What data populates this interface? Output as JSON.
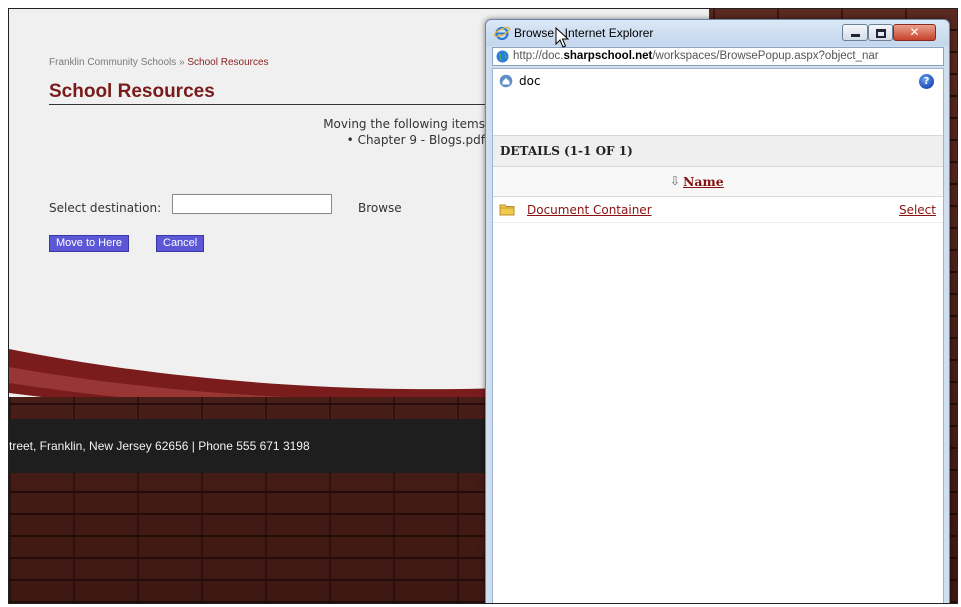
{
  "page": {
    "breadcrumb_root": "Franklin Community Schools",
    "breadcrumb_sep": " » ",
    "breadcrumb_current": "School Resources",
    "title": "School Resources",
    "moving_text": "Moving the following items",
    "moving_item": "Chapter 9 - Blogs.pdf",
    "select_label": "Select destination:",
    "destination_value": "",
    "browse_label": "Browse",
    "move_button": "Move to Here",
    "cancel_button": "Cancel",
    "footer_text": "treet, Franklin, New Jersey 62656 | Phone 555 671 3198"
  },
  "popup": {
    "title": "Browse - Internet Explorer",
    "url_prefix": "http://doc.",
    "url_domain": "sharpschool.net",
    "url_path": "/workspaces/BrowsePopup.aspx?object_nar",
    "root_label": "doc",
    "help_glyph": "?",
    "details_label": "DETAILS (1-1 OF 1)",
    "sort_arrow": "⇩",
    "name_header": "Name",
    "rows": [
      {
        "name": "Document Container",
        "action": "Select"
      }
    ]
  },
  "colors": {
    "accent_red": "#8a1111",
    "button_blue": "#5b57d6",
    "page_bg": "#f0f0f0",
    "footer_dark": "#1e1e1e",
    "window_chrome": "#cfdff0"
  },
  "icons": [
    "ie-icon",
    "globe-icon",
    "doc-icon",
    "help-icon",
    "folder-icon",
    "minimize-icon",
    "maximize-icon",
    "close-icon",
    "cursor-icon"
  ]
}
